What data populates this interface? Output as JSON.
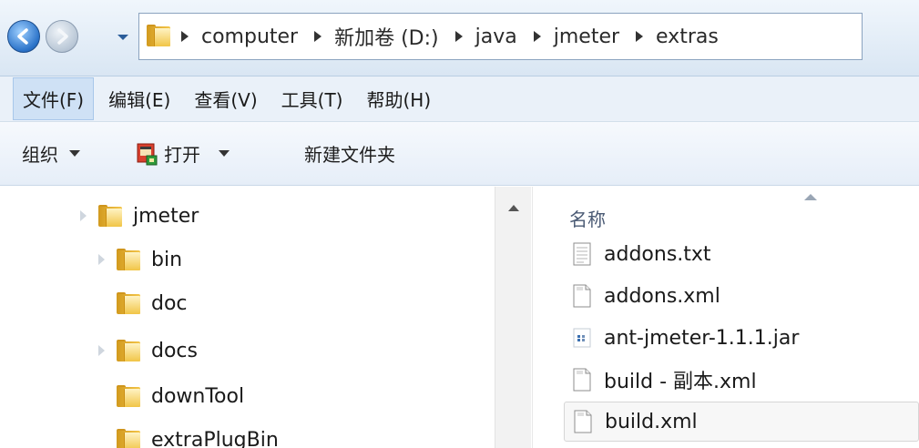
{
  "address_bar": {
    "crumbs": [
      "computer",
      "新加卷 (D:)",
      "java",
      "jmeter",
      "extras"
    ]
  },
  "menu": {
    "items": [
      "文件(F)",
      "编辑(E)",
      "查看(V)",
      "工具(T)",
      "帮助(H)"
    ],
    "active_index": 0
  },
  "toolbar": {
    "organize_label": "组织",
    "open_label": "打开",
    "new_folder_label": "新建文件夹"
  },
  "nav_tree": {
    "items": [
      {
        "label": "jmeter",
        "icon": "folder-icon",
        "level": 0
      },
      {
        "label": "bin",
        "icon": "folder-icon",
        "level": 1
      },
      {
        "label": "doc",
        "icon": "folder-icon",
        "level": 1
      },
      {
        "label": "docs",
        "icon": "folder-icon",
        "level": 1
      },
      {
        "label": "downTool",
        "icon": "folder-icon",
        "level": 1
      },
      {
        "label": "extraPlugBin",
        "icon": "folder-icon",
        "level": 1
      }
    ]
  },
  "file_list": {
    "column_name": "名称",
    "files": [
      {
        "name": "addons.txt",
        "icon": "text-file-icon"
      },
      {
        "name": "addons.xml",
        "icon": "xml-file-icon"
      },
      {
        "name": "ant-jmeter-1.1.1.jar",
        "icon": "jar-file-icon"
      },
      {
        "name": "build - 副本.xml",
        "icon": "xml-file-icon"
      },
      {
        "name": "build.xml",
        "icon": "xml-file-icon",
        "selected": true
      }
    ]
  },
  "colors": {
    "menu_bg": "#eaf1f9",
    "toolbar_bg": "#e6eef8",
    "folder": "#f1c547",
    "selection_border": "#d6d6d6"
  }
}
